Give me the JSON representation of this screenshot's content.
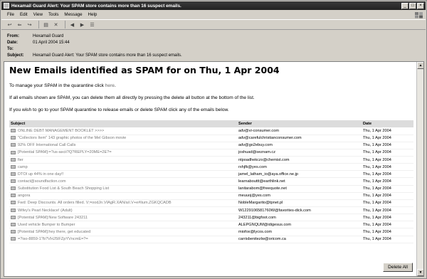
{
  "window": {
    "title": "Hexamail Guard Alert: Your SPAM store contains more than 16 suspect emails.",
    "controls": [
      "_",
      "□",
      "×"
    ]
  },
  "menu": [
    "File",
    "Edit",
    "View",
    "Tools",
    "Message",
    "Help"
  ],
  "toolbar": {
    "icons": [
      "reply-icon",
      "reply-all-icon",
      "forward-icon",
      "print-icon",
      "delete-icon",
      "previous-icon",
      "next-icon",
      "address-book-icon"
    ]
  },
  "headers": {
    "from_label": "From:",
    "from_value": "Hexamail Guard",
    "date_label": "Date:",
    "date_value": "01 April 2004 15:44",
    "to_label": "To:",
    "to_value": "",
    "subject_label": "Subject:",
    "subject_value": "Hexamail Guard Alert: Your SPAM store contains more than 16 suspect emails."
  },
  "message": {
    "heading": "New Emails identified as SPAM for on Thu, 1 Apr 2004",
    "manage_text": "To manage your SPAM in the quarantine click ",
    "manage_link": "here",
    "manage_end": ".",
    "line2": "If all emails shown are SPAM, you can delete them all directly by pressing the delete all button at the bottom of the list.",
    "line3": "If you wish to go to your SPAM quarantine to release emails or delete SPAM click any of the emails below."
  },
  "table": {
    "headers": [
      "Subject",
      "Sender",
      "Date"
    ],
    "rows": [
      {
        "subject": "ONLINE DEBT MANAGEMENT BOOKLET >>>>",
        "sender": "adv@vi-consumer.com",
        "date": "Thu, 1 Apr 2004"
      },
      {
        "subject": "\"Collectors Item\" 143 graphic photos of the Mel Gibson movie",
        "sender": "adv@carefulchristianconsumer.com",
        "date": "Thu, 1 Apr 2004"
      },
      {
        "subject": "92% OFF International Call Calls",
        "sender": "adv@go2ebuy.com",
        "date": "Thu, 1 Apr 2004"
      },
      {
        "subject": "[Potential SPAM]:=?us-ascii?Q?REPLY=20ME=2E?=",
        "sender": "joshuad@seznam.cz",
        "date": "Thu, 1 Apr 2004"
      },
      {
        "subject": "fier",
        "sender": "ntpoadhekczx@chemist.com",
        "date": "Thu, 1 Apr 2004"
      },
      {
        "subject": "camp",
        "sender": "rxhjfk@yes.com",
        "date": "Thu, 1 Apr 2004"
      },
      {
        "subject": "DTOI up 44% in one day!!",
        "sender": "jamel_latham_io@aya.office.ne.jp",
        "date": "Thu, 1 Apr 2004"
      },
      {
        "subject": "contact@soundfaction.com",
        "sender": "learnabouttt@earthlink.net",
        "date": "Thu, 1 Apr 2004"
      },
      {
        "subject": "Substitution Food List & South Beach Shopping List",
        "sender": "lanitarabom@freequote.net",
        "date": "Thu, 1 Apr 2004"
      },
      {
        "subject": "angora",
        "sender": "meuuoj@yes.com",
        "date": "Thu, 1 Apr 2004"
      },
      {
        "subject": "Fwd: Deep Discounts. All orders filled. V;=oodJn.VIAgR.XAN/a/i.V+e#lium.ZGKQCADB",
        "sender": "NobleMargarito@tpnet.pl",
        "date": "Thu, 1 Apr 2004"
      },
      {
        "subject": "Wifey's Pearl Necklace! (Adult)",
        "sender": "W1229106581760W@favorites-dick.com",
        "date": "Thu, 1 Apr 2004"
      },
      {
        "subject": "[Potential SPAM]:New Software 243211",
        "sender": "243211@bigfoot.com",
        "date": "Thu, 1 Apr 2004"
      },
      {
        "subject": "Used vehicle Bumper to Bumper",
        "sender": "ALEPGNQUM@idigesus.com",
        "date": "Thu, 1 Apr 2004"
      },
      {
        "subject": "[Potential SPAM]:hey there, get educated",
        "sender": "miofox@lycos.com",
        "date": "Thu, 1 Apr 2004"
      },
      {
        "subject": "=?iso-8859-1?b?VHJ5IFZpYVncmE=?=",
        "sender": "carrisbenitezlw@oricom.ca",
        "date": "Thu, 1 Apr 2004"
      }
    ]
  },
  "delete_all_label": "Delete All"
}
